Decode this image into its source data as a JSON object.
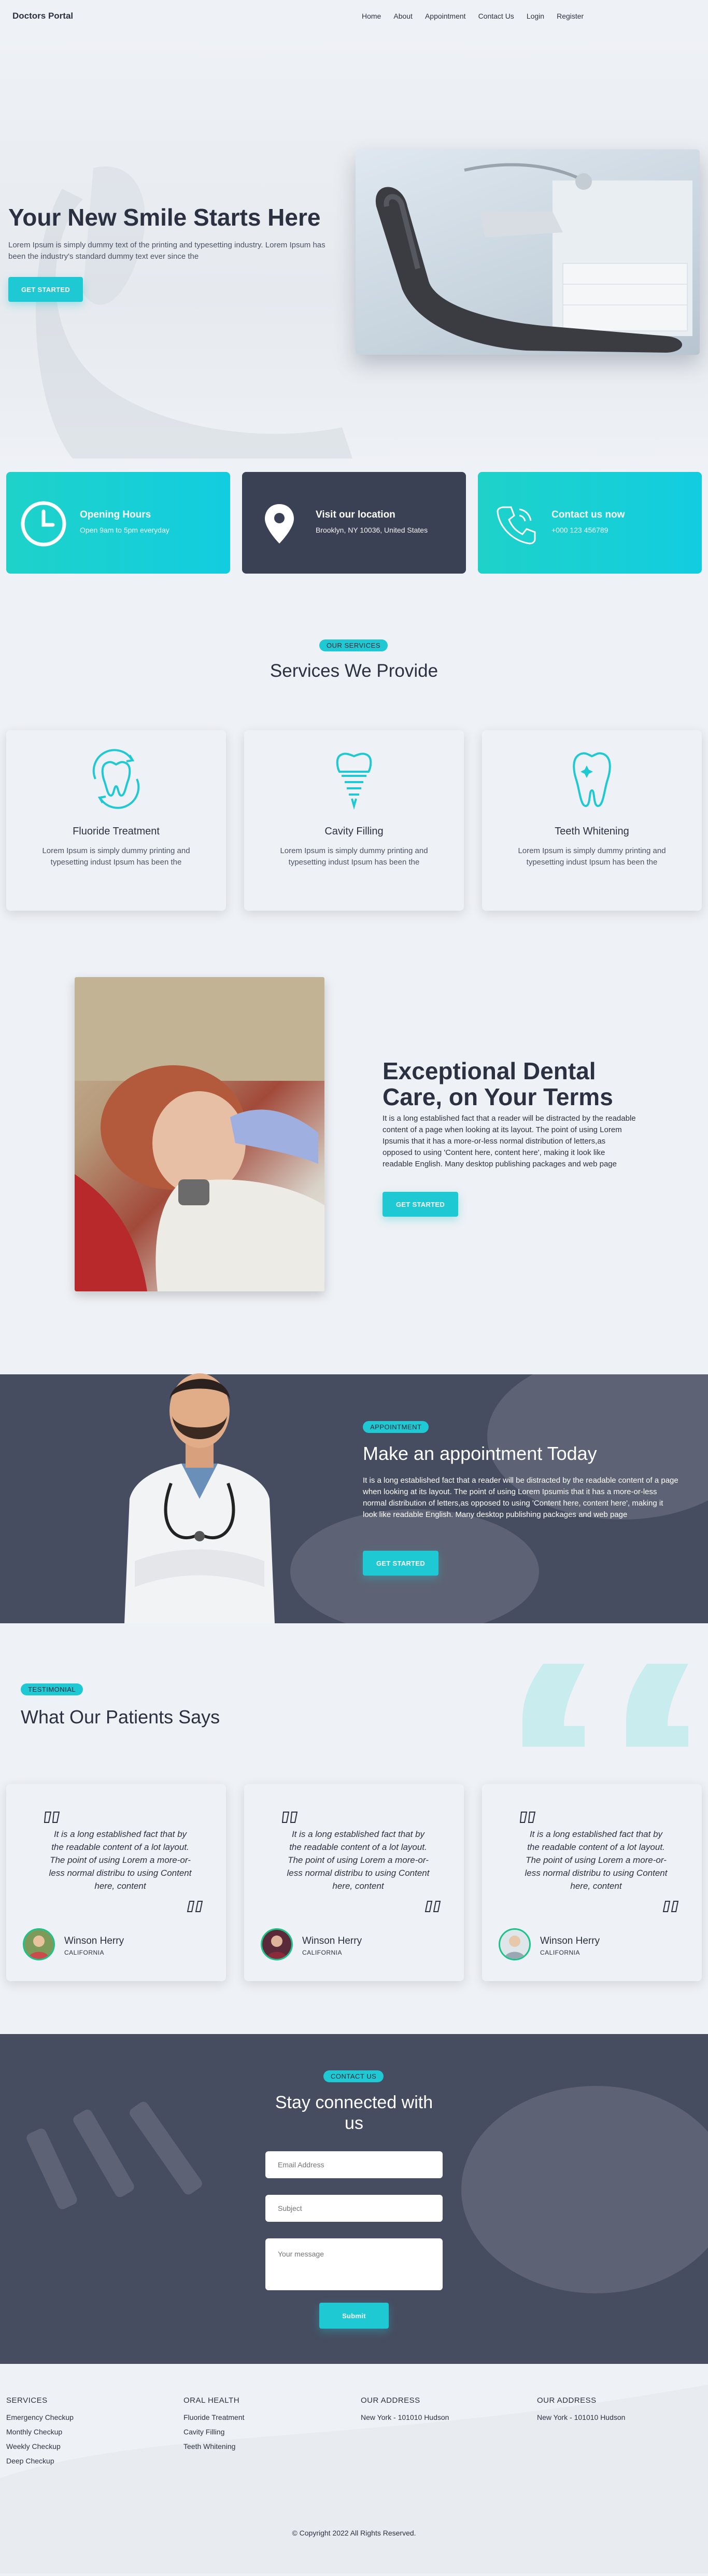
{
  "nav": {
    "brand": "Doctors Portal",
    "items": [
      "Home",
      "About",
      "Appointment",
      "Contact Us",
      "Login",
      "Register"
    ]
  },
  "hero": {
    "title": "Your New Smile Starts Here",
    "text": "Lorem Ipsum is simply dummy text of the printing and typesetting industry. Lorem Ipsum has been the industry's standard dummy text ever since the",
    "button": "GET STARTED"
  },
  "info": [
    {
      "title": "Opening Hours",
      "text": "Open 9am to 5pm everyday",
      "icon": "clock-icon"
    },
    {
      "title": "Visit our location",
      "text": "Brooklyn, NY 10036, United States",
      "icon": "location-pin-icon"
    },
    {
      "title": "Contact us now",
      "text": "+000 123 456789",
      "icon": "phone-icon"
    }
  ],
  "services": {
    "tag": "OUR SERVICES",
    "title": "Services We Provide",
    "items": [
      {
        "title": "Fluoride Treatment",
        "text": "Lorem Ipsum is simply dummy printing and typesetting indust Ipsum has been the"
      },
      {
        "title": "Cavity Filling",
        "text": "Lorem Ipsum is simply dummy printing and typesetting indust Ipsum has been the"
      },
      {
        "title": "Teeth Whitening",
        "text": "Lorem Ipsum is simply dummy printing and typesetting indust Ipsum has been the"
      }
    ]
  },
  "dental": {
    "title": "Exceptional Dental Care, on Your Terms",
    "text": "It is a long established fact that a reader will be distracted by the readable content of a page when looking at its layout. The point of using Lorem Ipsumis that it has a more-or-less normal distribution of letters,as opposed to using 'Content here, content here', making it look like readable English. Many desktop publishing packages and web page",
    "button": "GET STARTED"
  },
  "appointment": {
    "tag": "APPOINTMENT",
    "title": "Make an appointment Today",
    "text": "It is a long established fact that a reader will be distracted by the readable content of a page when looking at its layout. The point of using Lorem Ipsumis that it has a more-or-less normal distribution of letters,as opposed to using 'Content here, content here', making it look like readable English. Many desktop publishing packages and web page",
    "button": "GET STARTED"
  },
  "testimonial": {
    "tag": "TESTIMONIAL",
    "title": "What Our Patients Says",
    "items": [
      {
        "text": "It is a long established fact that by the readable content of a lot layout. The point of using Lorem a more-or-less normal distribu to using Content here, content",
        "name": "Winson Herry",
        "location": "CALIFORNIA"
      },
      {
        "text": "It is a long established fact that by the readable content of a lot layout. The point of using Lorem a more-or-less normal distribu to using Content here, content",
        "name": "Winson Herry",
        "location": "CALIFORNIA"
      },
      {
        "text": "It is a long established fact that by the readable content of a lot layout. The point of using Lorem a more-or-less normal distribu to using Content here, content",
        "name": "Winson Herry",
        "location": "CALIFORNIA"
      }
    ]
  },
  "contact": {
    "tag": "CONTACT US",
    "title": "Stay connected with us",
    "email_placeholder": "Email Address",
    "subject_placeholder": "Subject",
    "message_placeholder": "Your message",
    "submit": "Submit"
  },
  "footer": {
    "columns": [
      {
        "heading": "SERVICES",
        "items": [
          "Emergency Checkup",
          "Monthly Checkup",
          "Weekly Checkup",
          "Deep Checkup"
        ]
      },
      {
        "heading": "ORAL HEALTH",
        "items": [
          "Fluoride Treatment",
          "Cavity Filling",
          "Teeth Whitening"
        ]
      },
      {
        "heading": "OUR ADDRESS",
        "items": [
          "New York - 101010 Hudson"
        ]
      },
      {
        "heading": "OUR ADDRESS",
        "items": [
          "New York - 101010 Hudson"
        ]
      }
    ],
    "copyright": "© Copyright 2022 All Rights Reserved."
  },
  "colors": {
    "accent": "#1ec9d4",
    "dark": "#3b4154",
    "section_dark": "#464d61",
    "text": "#2b3140"
  }
}
